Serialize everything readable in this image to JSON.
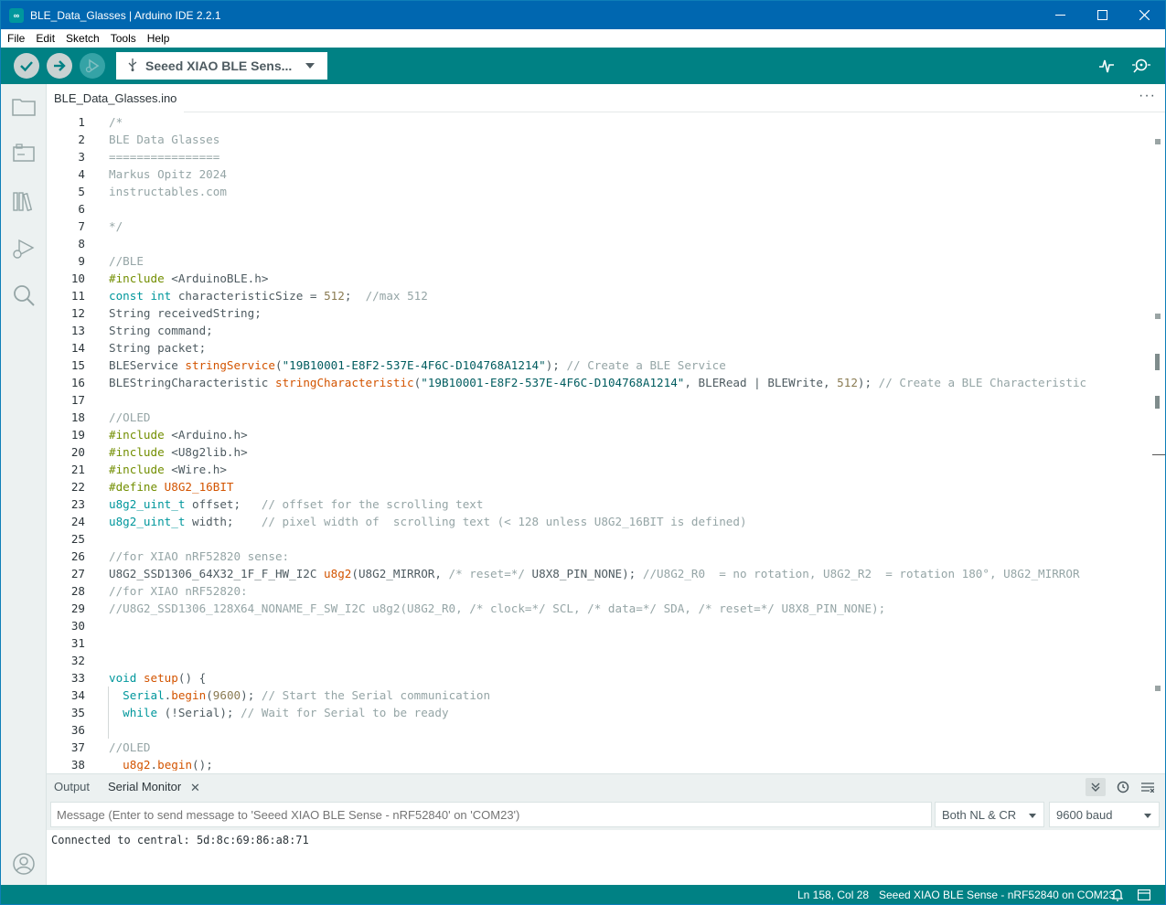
{
  "window": {
    "title": "BLE_Data_Glasses | Arduino IDE 2.2.1",
    "app_icon": "arduino-infinity-icon",
    "minimize": "—",
    "maximize": "☐",
    "close": "✕"
  },
  "menu": [
    "File",
    "Edit",
    "Sketch",
    "Tools",
    "Help"
  ],
  "toolbar": {
    "board": "Seeed XIAO BLE Sens...",
    "verify_icon": "check-icon",
    "upload_icon": "arrow-right-icon",
    "debug_icon": "debug-icon"
  },
  "sidebar": [
    "folder-icon",
    "board-manager-icon",
    "library-icon",
    "debug-icon",
    "search-icon"
  ],
  "tab": {
    "name": "BLE_Data_Glasses.ino",
    "more": "···"
  },
  "code": [
    {
      "n": "1",
      "t": [
        [
          "cmt",
          "/*"
        ]
      ]
    },
    {
      "n": "2",
      "t": [
        [
          "cmt",
          "BLE Data Glasses"
        ]
      ]
    },
    {
      "n": "3",
      "t": [
        [
          "cmt",
          "================"
        ]
      ]
    },
    {
      "n": "4",
      "t": [
        [
          "cmt",
          "Markus Opitz 2024"
        ]
      ]
    },
    {
      "n": "5",
      "t": [
        [
          "cmt",
          "instructables.com"
        ]
      ]
    },
    {
      "n": "6",
      "t": []
    },
    {
      "n": "7",
      "t": [
        [
          "cmt",
          "*/"
        ]
      ]
    },
    {
      "n": "8",
      "t": []
    },
    {
      "n": "9",
      "t": [
        [
          "cmt",
          "//BLE"
        ]
      ]
    },
    {
      "n": "10",
      "t": [
        [
          "pp",
          "#include"
        ],
        [
          "plain",
          " <ArduinoBLE.h>"
        ]
      ]
    },
    {
      "n": "11",
      "t": [
        [
          "kw",
          "const"
        ],
        [
          "plain",
          " "
        ],
        [
          "kw",
          "int"
        ],
        [
          "plain",
          " characteristicSize = "
        ],
        [
          "num",
          "512"
        ],
        [
          "plain",
          ";  "
        ],
        [
          "cmt",
          "//max 512"
        ]
      ]
    },
    {
      "n": "12",
      "t": [
        [
          "plain",
          "String receivedString;"
        ]
      ]
    },
    {
      "n": "13",
      "t": [
        [
          "plain",
          "String command;"
        ]
      ]
    },
    {
      "n": "14",
      "t": [
        [
          "plain",
          "String packet;"
        ]
      ]
    },
    {
      "n": "15",
      "t": [
        [
          "plain",
          "BLEService "
        ],
        [
          "fn",
          "stringService"
        ],
        [
          "plain",
          "("
        ],
        [
          "str",
          "\"19B10001-E8F2-537E-4F6C-D104768A1214\""
        ],
        [
          "plain",
          "); "
        ],
        [
          "cmt",
          "// Create a BLE Service"
        ]
      ]
    },
    {
      "n": "16",
      "t": [
        [
          "plain",
          "BLEStringCharacteristic "
        ],
        [
          "fn",
          "stringCharacteristic"
        ],
        [
          "plain",
          "("
        ],
        [
          "str",
          "\"19B10001-E8F2-537E-4F6C-D104768A1214\""
        ],
        [
          "plain",
          ", BLERead | BLEWrite, "
        ],
        [
          "num",
          "512"
        ],
        [
          "plain",
          "); "
        ],
        [
          "cmt",
          "// Create a BLE Characteristic"
        ]
      ]
    },
    {
      "n": "17",
      "t": []
    },
    {
      "n": "18",
      "t": [
        [
          "cmt",
          "//OLED"
        ]
      ]
    },
    {
      "n": "19",
      "t": [
        [
          "pp",
          "#include"
        ],
        [
          "plain",
          " <Arduino.h>"
        ]
      ]
    },
    {
      "n": "20",
      "t": [
        [
          "pp",
          "#include"
        ],
        [
          "plain",
          " <U8g2lib.h>"
        ]
      ]
    },
    {
      "n": "21",
      "t": [
        [
          "pp",
          "#include"
        ],
        [
          "plain",
          " <Wire.h>"
        ]
      ]
    },
    {
      "n": "22",
      "t": [
        [
          "pp",
          "#define"
        ],
        [
          "fn",
          " U8G2_16BIT"
        ]
      ]
    },
    {
      "n": "23",
      "t": [
        [
          "typ",
          "u8g2_uint_t"
        ],
        [
          "plain",
          " offset;   "
        ],
        [
          "cmt",
          "// offset for the scrolling text"
        ]
      ]
    },
    {
      "n": "24",
      "t": [
        [
          "typ",
          "u8g2_uint_t"
        ],
        [
          "plain",
          " width;    "
        ],
        [
          "cmt",
          "// pixel width of  scrolling text (< 128 unless U8G2_16BIT is defined)"
        ]
      ]
    },
    {
      "n": "25",
      "t": []
    },
    {
      "n": "26",
      "t": [
        [
          "cmt",
          "//for XIAO nRF52820 sense:"
        ]
      ]
    },
    {
      "n": "27",
      "t": [
        [
          "plain",
          "U8G2_SSD1306_64X32_1F_F_HW_I2C "
        ],
        [
          "fn",
          "u8g2"
        ],
        [
          "plain",
          "(U8G2_MIRROR, "
        ],
        [
          "cmt",
          "/* reset=*/"
        ],
        [
          "plain",
          " U8X8_PIN_NONE); "
        ],
        [
          "cmt",
          "//U8G2_R0  = no rotation, U8G2_R2  = rotation 180°, U8G2_MIRROR"
        ]
      ]
    },
    {
      "n": "28",
      "t": [
        [
          "cmt",
          "//for XIAO nRF52820:"
        ]
      ]
    },
    {
      "n": "29",
      "t": [
        [
          "cmt",
          "//U8G2_SSD1306_128X64_NONAME_F_SW_I2C u8g2(U8G2_R0, /* clock=*/ SCL, /* data=*/ SDA, /* reset=*/ U8X8_PIN_NONE);"
        ]
      ]
    },
    {
      "n": "30",
      "t": []
    },
    {
      "n": "31",
      "t": []
    },
    {
      "n": "32",
      "t": []
    },
    {
      "n": "33",
      "t": [
        [
          "kw",
          "void"
        ],
        [
          "plain",
          " "
        ],
        [
          "fn",
          "setup"
        ],
        [
          "plain",
          "() {"
        ]
      ]
    },
    {
      "n": "34",
      "t": [
        [
          "plain",
          "  "
        ],
        [
          "typ",
          "Serial"
        ],
        [
          "plain",
          "."
        ],
        [
          "fn",
          "begin"
        ],
        [
          "plain",
          "("
        ],
        [
          "num",
          "9600"
        ],
        [
          "plain",
          "); "
        ],
        [
          "cmt",
          "// Start the Serial communication"
        ]
      ]
    },
    {
      "n": "35",
      "t": [
        [
          "plain",
          "  "
        ],
        [
          "kw",
          "while"
        ],
        [
          "plain",
          " (!Serial); "
        ],
        [
          "cmt",
          "// Wait for Serial to be ready"
        ]
      ]
    },
    {
      "n": "36",
      "t": []
    },
    {
      "n": "37",
      "t": [
        [
          "cmt",
          "//OLED"
        ]
      ]
    },
    {
      "n": "38",
      "t": [
        [
          "plain",
          "  "
        ],
        [
          "fn",
          "u8g2"
        ],
        [
          "plain",
          "."
        ],
        [
          "fn",
          "begin"
        ],
        [
          "plain",
          "();"
        ]
      ]
    }
  ],
  "panel": {
    "output_tab": "Output",
    "serial_tab": "Serial Monitor",
    "close": "✕",
    "message_placeholder": "Message (Enter to send message to 'Seeed XIAO BLE Sense - nRF52840' on 'COM23')",
    "line_ending": "Both NL & CR",
    "baud": "9600 baud",
    "serial_output": "Connected to central: 5d:8c:69:86:a8:71"
  },
  "status": {
    "position": "Ln 158, Col 28",
    "board": "Seeed XIAO BLE Sense - nRF52840 on COM23"
  }
}
